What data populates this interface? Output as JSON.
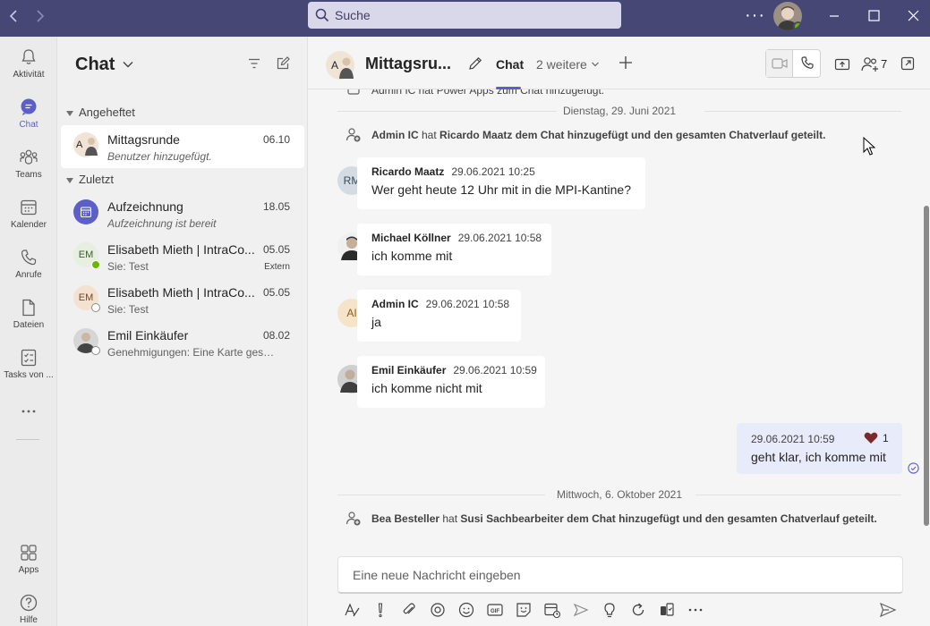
{
  "titlebar": {
    "search_placeholder": "Suche"
  },
  "rail": {
    "items": [
      {
        "label": "Aktivität"
      },
      {
        "label": "Chat"
      },
      {
        "label": "Teams"
      },
      {
        "label": "Kalender"
      },
      {
        "label": "Anrufe"
      },
      {
        "label": "Dateien"
      },
      {
        "label": "Tasks von ..."
      },
      {
        "label": "Apps"
      },
      {
        "label": "Hilfe"
      }
    ]
  },
  "chatlist": {
    "title": "Chat",
    "sections": {
      "pinned": "Angeheftet",
      "recent": "Zuletzt"
    },
    "pinned_items": [
      {
        "avatar": "A",
        "name": "Mittagsrunde",
        "preview": "Benutzer hinzugefügt.",
        "time": "06.10"
      }
    ],
    "recent_items": [
      {
        "name": "Aufzeichnung",
        "preview": "Aufzeichnung ist bereit",
        "time": "18.05",
        "extra": ""
      },
      {
        "avatar": "EM",
        "name": "Elisabeth Mieth | IntraCo...",
        "preview": "Sie: Test",
        "time": "05.05",
        "extra": "Extern"
      },
      {
        "avatar": "EM",
        "name": "Elisabeth Mieth | IntraCo...",
        "preview": "Sie: Test",
        "time": "05.05",
        "extra": ""
      },
      {
        "name": "Emil Einkäufer",
        "preview": "Genehmigungen: Eine Karte gese...",
        "time": "08.02",
        "extra": ""
      }
    ]
  },
  "header": {
    "avatar": "A",
    "title": "Mittagsru...",
    "tab_chat": "Chat",
    "tab_more": "2 weitere",
    "participants_count": "7"
  },
  "messages": {
    "top_partial": "Admin IC hat Power Apps zum Chat hinzugefügt.",
    "date1": "Dienstag, 29. Juni 2021",
    "sys1": {
      "actor": "Admin IC",
      "mid": " hat ",
      "target": "Ricardo Maatz",
      "rest": " dem Chat hinzugefügt und den gesamten Chatverlauf geteilt."
    },
    "list": [
      {
        "avatar": "RM",
        "sender": "Ricardo Maatz",
        "time": "29.06.2021 10:25",
        "text": "Wer geht heute 12 Uhr mit in die MPI-Kantine?"
      },
      {
        "avatar": "",
        "sender": "Michael Köllner",
        "time": "29.06.2021 10:58",
        "text": "ich komme mit"
      },
      {
        "avatar": "AI",
        "sender": "Admin IC",
        "time": "29.06.2021 10:58",
        "text": "ja"
      },
      {
        "avatar": "",
        "sender": "Emil Einkäufer",
        "time": "29.06.2021 10:59",
        "text": "ich komme nicht mit"
      }
    ],
    "own": {
      "time": "29.06.2021 10:59",
      "reaction_count": "1",
      "text": "geht klar, ich komme mit"
    },
    "date2": "Mittwoch, 6. Oktober 2021",
    "sys2": {
      "actor": "Bea Besteller",
      "mid": " hat ",
      "target": "Susi Sachbearbeiter",
      "rest": " dem Chat hinzugefügt und den gesamten Chatverlauf geteilt."
    }
  },
  "compose": {
    "placeholder": "Eine neue Nachricht eingeben"
  },
  "colors": {
    "titlebar": "#464775",
    "accent": "#5b5fc7",
    "own_bubble": "#e8ebfa",
    "heart": "#7a2a2a"
  }
}
